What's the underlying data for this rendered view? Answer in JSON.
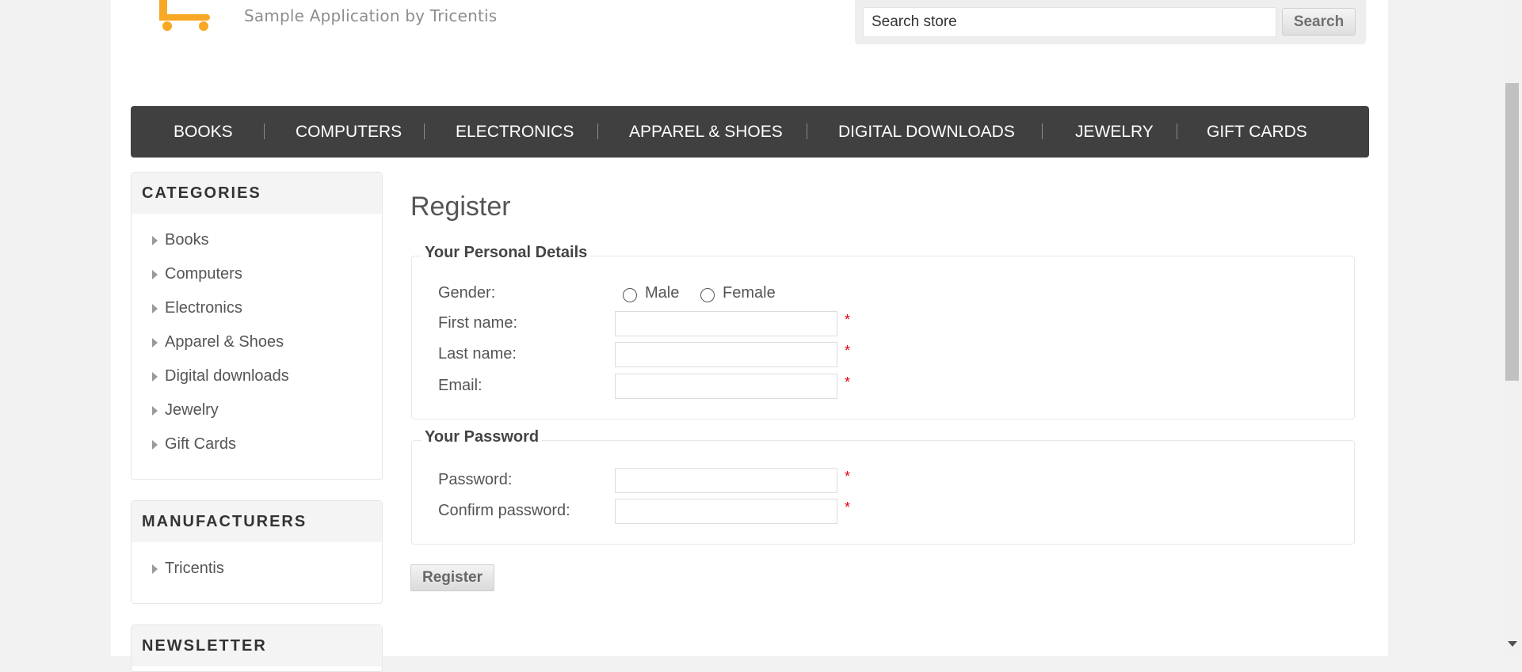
{
  "header": {
    "tagline": "Sample Application by Tricentis",
    "search_placeholder": "Search store",
    "search_button": "Search"
  },
  "top_menu": [
    "BOOKS",
    "COMPUTERS",
    "ELECTRONICS",
    "APPAREL & SHOES",
    "DIGITAL DOWNLOADS",
    "JEWELRY",
    "GIFT CARDS"
  ],
  "categories": {
    "title": "CATEGORIES",
    "items": [
      "Books",
      "Computers",
      "Electronics",
      "Apparel & Shoes",
      "Digital downloads",
      "Jewelry",
      "Gift Cards"
    ]
  },
  "manufacturers": {
    "title": "MANUFACTURERS",
    "items": [
      "Tricentis"
    ]
  },
  "newsletter": {
    "title": "NEWSLETTER"
  },
  "form": {
    "page_title": "Register",
    "personal": {
      "legend": "Your Personal Details",
      "gender_label": "Gender:",
      "male": "Male",
      "female": "Female",
      "first_name": "First name:",
      "last_name": "Last name:",
      "email": "Email:"
    },
    "password": {
      "legend": "Your Password",
      "password": "Password:",
      "confirm": "Confirm password:"
    },
    "required_mark": "*",
    "submit": "Register"
  },
  "colors": {
    "menu_bg": "#404040",
    "logo_orange": "#f9a825",
    "required": "#e4000f"
  }
}
